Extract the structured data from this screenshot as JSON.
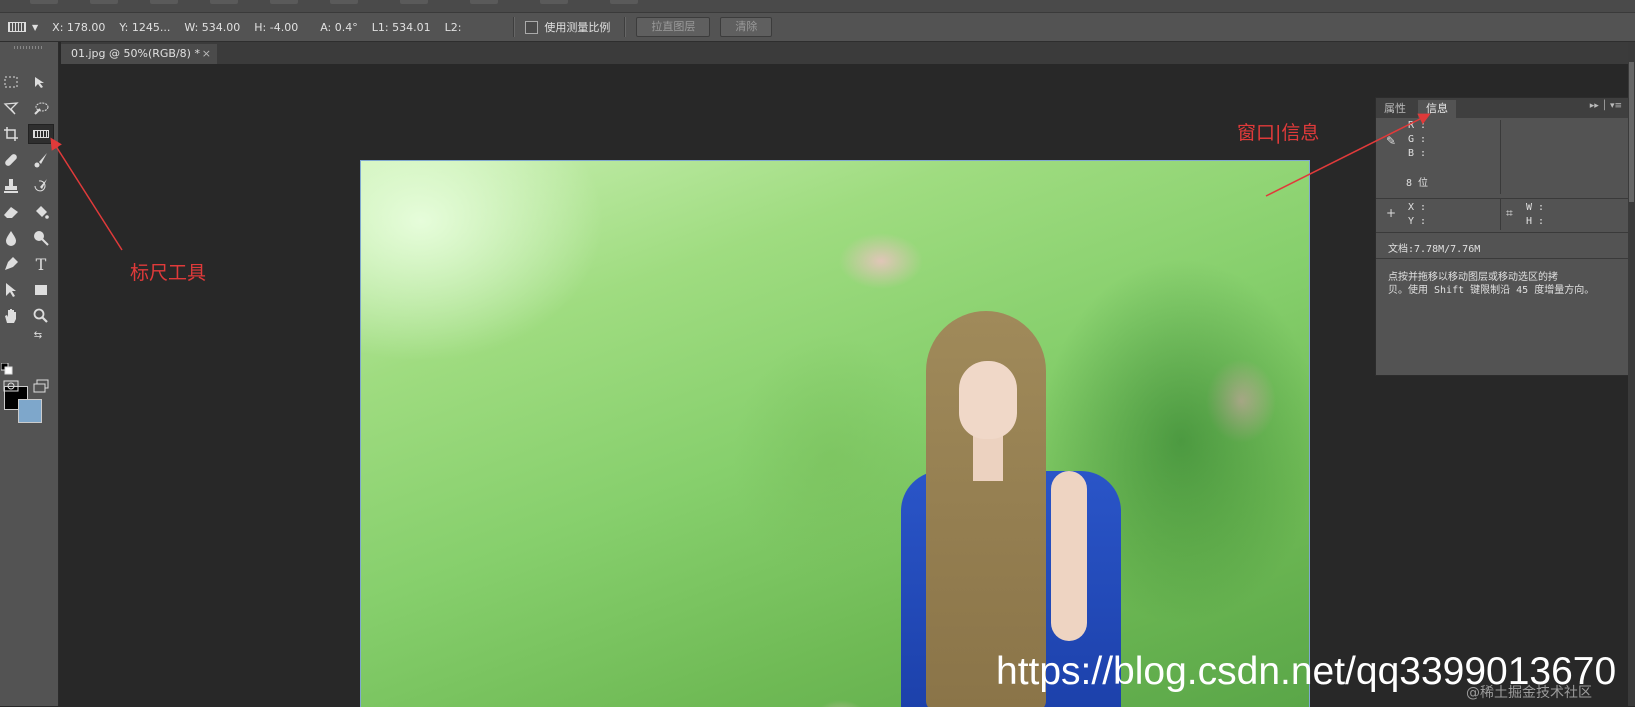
{
  "options_bar": {
    "tool_icon": "ruler-icon",
    "x": "X: 178.00",
    "y": "Y: 1245...",
    "w": "W: 534.00",
    "h": "H: -4.00",
    "a": "A: 0.4°",
    "l1": "L1: 534.01",
    "l2": "L2:",
    "use_scale_label": "使用测量比例",
    "straighten_button": "拉直图层",
    "clear_button": "清除"
  },
  "document_tab": {
    "title": "01.jpg @ 50%(RGB/8) *",
    "close": "×"
  },
  "tools": {
    "icons": [
      "marquee-icon",
      "move-icon",
      "lasso-icon",
      "quick-select-icon",
      "crop-icon",
      "ruler-icon",
      "healing-icon",
      "brush-icon",
      "stamp-icon",
      "history-brush-icon",
      "eraser-icon",
      "paint-bucket-icon",
      "blur-icon",
      "dodge-icon",
      "pen-icon",
      "type-icon",
      "path-select-icon",
      "shape-icon",
      "hand-icon",
      "zoom-icon"
    ],
    "type_label": "T",
    "foreground_color": "#000000",
    "background_color": "#7ea7cb"
  },
  "info_panel": {
    "tab_properties": "属性",
    "tab_info": "信息",
    "r": "R :",
    "g": "G :",
    "b": "B :",
    "bits": "8 位",
    "x": "X :",
    "y": "Y :",
    "w": "W :",
    "h": "H :",
    "doc": "文档:7.78M/7.76M",
    "hint_line1": "点按并拖移以移动图层或移动选区的拷",
    "hint_line2": "贝。使用 Shift 键限制沿 45 度增量方向。"
  },
  "annotations": {
    "ruler_tool": "标尺工具",
    "window_info": "窗口|信息",
    "color": "#e03a3a"
  },
  "watermark": {
    "url": "https://blog.csdn.net/qq3399013670",
    "site": "@稀土掘金技术社区"
  }
}
